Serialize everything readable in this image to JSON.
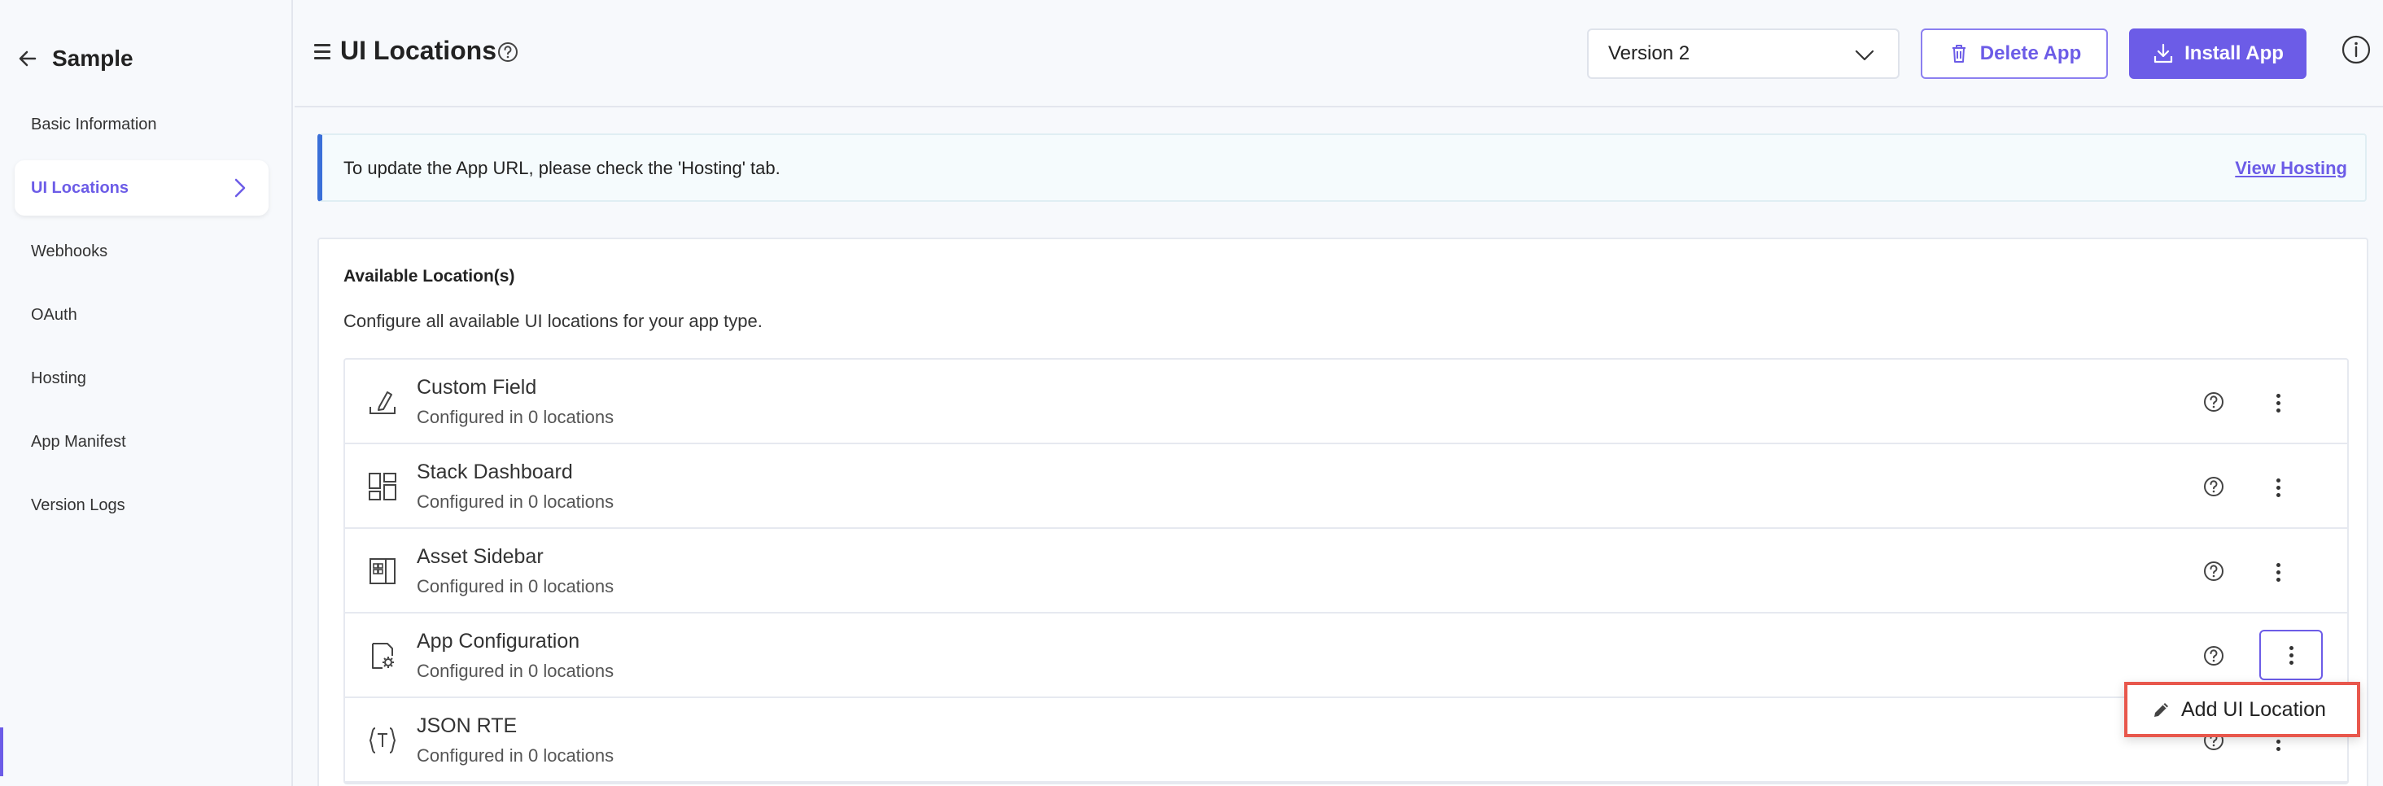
{
  "sidebar": {
    "app_name": "Sample",
    "items": [
      {
        "label": "Basic Information"
      },
      {
        "label": "UI Locations"
      },
      {
        "label": "Webhooks"
      },
      {
        "label": "OAuth"
      },
      {
        "label": "Hosting"
      },
      {
        "label": "App Manifest"
      },
      {
        "label": "Version Logs"
      }
    ],
    "active_item": "UI Locations"
  },
  "header": {
    "title": "UI Locations",
    "version_selected": "Version 2",
    "delete_label": "Delete App",
    "install_label": "Install App"
  },
  "banner": {
    "text": "To update the App URL, please check the 'Hosting' tab.",
    "link": "View Hosting"
  },
  "card": {
    "title": "Available Location(s)",
    "description": "Configure all available UI locations for your app type."
  },
  "locations": [
    {
      "name": "Custom Field",
      "status": "Configured in 0 locations",
      "icon": "custom-field-icon"
    },
    {
      "name": "Stack Dashboard",
      "status": "Configured in 0 locations",
      "icon": "dashboard-icon"
    },
    {
      "name": "Asset Sidebar",
      "status": "Configured in 0 locations",
      "icon": "asset-sidebar-icon"
    },
    {
      "name": "App Configuration",
      "status": "Configured in 0 locations",
      "icon": "app-config-icon"
    },
    {
      "name": "JSON RTE",
      "status": "Configured in 0 locations",
      "icon": "json-rte-icon"
    }
  ],
  "menu": {
    "add_label": "Add UI Location"
  },
  "colors": {
    "accent": "#6c5ce7",
    "highlight": "#e8574c",
    "banner_border": "#3a6fd8"
  }
}
